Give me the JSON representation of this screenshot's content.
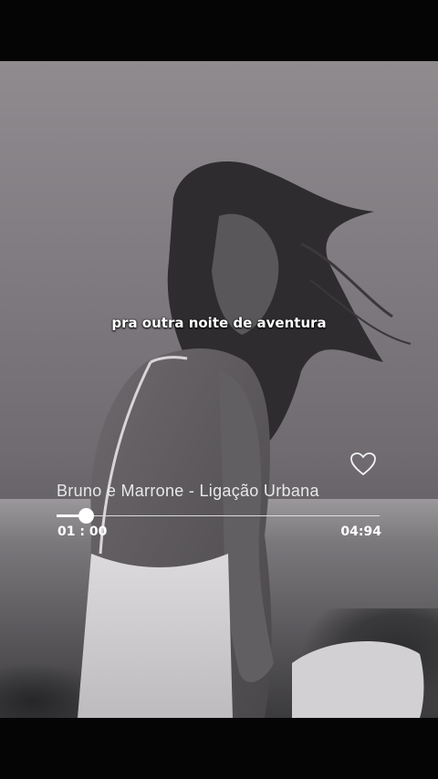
{
  "lyrics": {
    "current_line": "pra outra noite de aventura"
  },
  "player": {
    "track_title": "Bruno e Marrone - Ligação Urbana",
    "elapsed": "01 : 00",
    "duration": "04:94",
    "progress_fraction": 0.09,
    "like_icon": "heart-outline-icon"
  },
  "colors": {
    "text": "#ffffff",
    "background": "#000000"
  }
}
